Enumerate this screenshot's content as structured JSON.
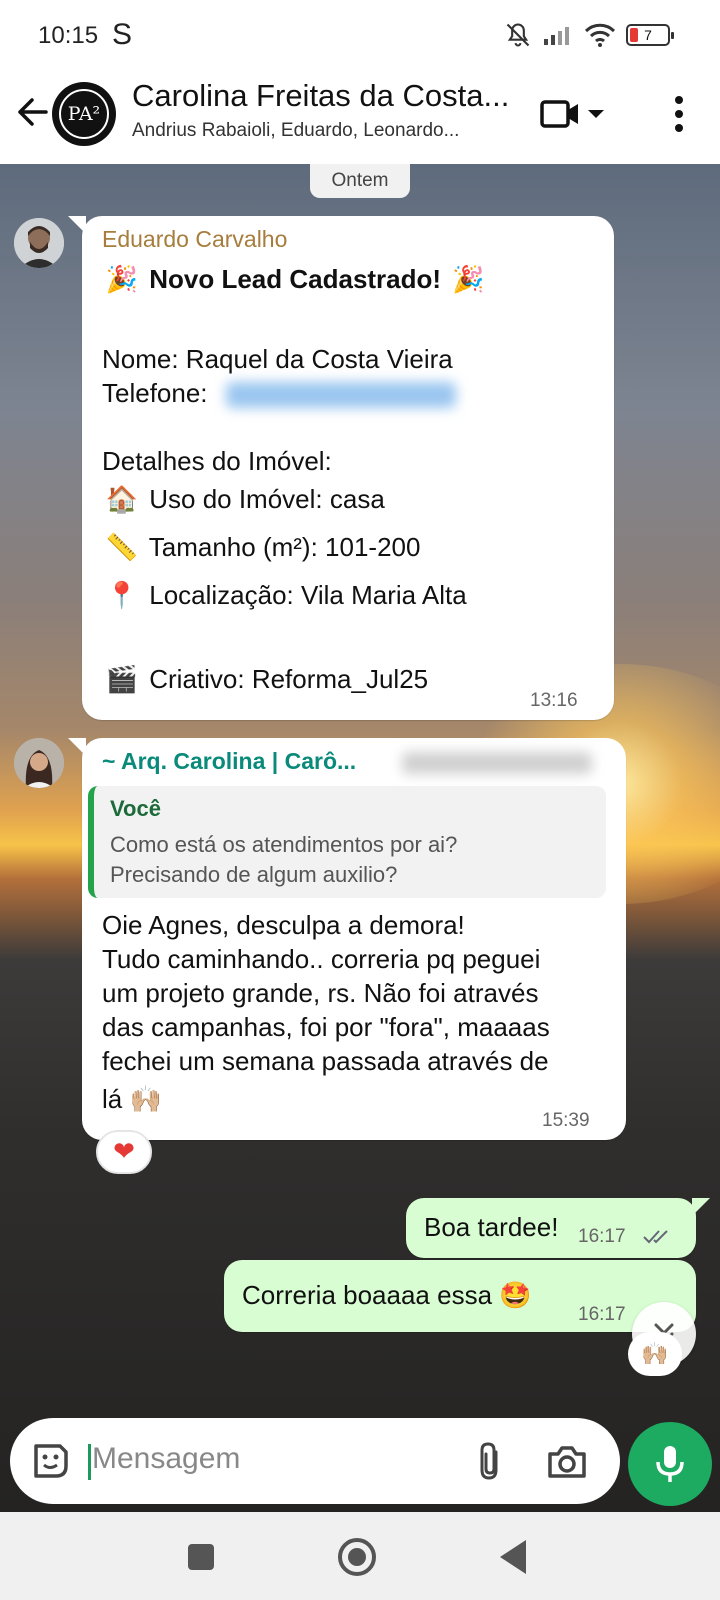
{
  "status_bar": {
    "time": "10:15",
    "carrier_glyph": "S",
    "battery": "7"
  },
  "header": {
    "title": "Carolina Freitas da Costa...",
    "subtitle": "Andrius Rabaioli, Eduardo, Leonardo...",
    "avatar_text": "PA²",
    "icons": [
      "back-arrow-icon",
      "video-call-icon",
      "dropdown-caret-icon",
      "more-options-icon"
    ]
  },
  "chat": {
    "date_chip": "Ontem",
    "message1": {
      "sender": "Eduardo Carvalho",
      "sender_color": "#a67d3c",
      "title": "Novo Lead Cadastrado!",
      "title_emoji": "🎉",
      "line_nome": "Nome: Raquel da Costa Vieira",
      "line_telefone": "Telefone:",
      "details_heading": "Detalhes do Imóvel:",
      "uso": "Uso do Imóvel: casa",
      "uso_emoji": "🏠",
      "tamanho": "Tamanho (m²): 101-200",
      "tamanho_emoji": "📏",
      "localizacao": "Localização: Vila Maria Alta",
      "localizacao_emoji": "📍",
      "criativo": "Criativo: Reforma_Jul25",
      "criativo_emoji": "🎬",
      "time": "13:16"
    },
    "message2": {
      "sender": "~ Arq. Carolina | Carô...",
      "sender_color": "#0a8a7a",
      "quote_author": "Você",
      "quote_line1": "Como está os atendimentos por ai?",
      "quote_line2": "Precisando de algum auxilio?",
      "line1": "Oie Agnes, desculpa a demora!",
      "line2": "Tudo caminhando.. correria pq peguei",
      "line3": "um projeto grande, rs. Não foi através",
      "line4": "das campanhas, foi por \"fora\", maaaas",
      "line5": "fechei um semana passada através de",
      "line6": "lá",
      "line6_emoji": "🙌🏼",
      "time": "15:39",
      "reaction": "❤"
    },
    "out1": {
      "text": "Boa tardee!",
      "time": "16:17"
    },
    "out2": {
      "text": "Correria boaaaa essa",
      "emoji": "🤩",
      "time": "16:17",
      "reaction": "🙌🏼"
    }
  },
  "input": {
    "placeholder": "Mensagem"
  },
  "colors": {
    "accent_green": "#1daa61",
    "outgoing_bubble": "#d9fdd3",
    "incoming_bubble": "#ffffff"
  }
}
